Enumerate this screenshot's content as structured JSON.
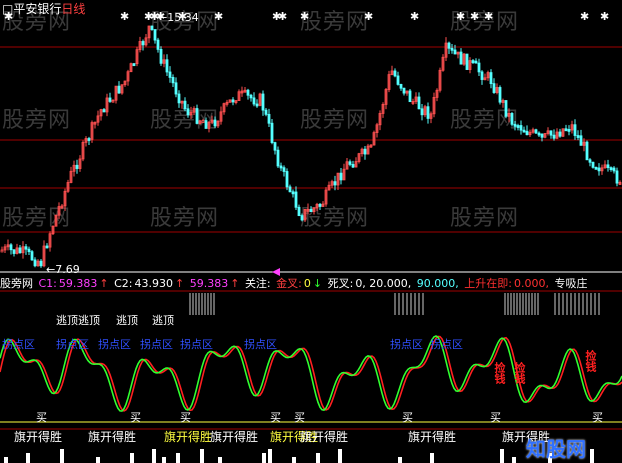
{
  "header": {
    "stock_name": "平安银行",
    "period": "日线"
  },
  "price_chart": {
    "high_label": "15.34",
    "low_label": "7.69"
  },
  "indicator_bar": {
    "source": "股旁网",
    "c1_label": "C1:",
    "c1_value": "59.383",
    "c2_label": "C2:",
    "c2_value": "43.930",
    "c3_value": "59.383",
    "focus_label": "关注:",
    "golden_cross_label": "金叉:",
    "golden_cross_value": "0",
    "death_cross_label": "死叉:",
    "death_cross_values": "0, 20.000,",
    "line90": "90.000,",
    "rise_start_label": "上升在即:",
    "rise_start_value": "0.000,",
    "zhuang_label": "专吸庄"
  },
  "signals": {
    "escape_top": [
      "逃顶",
      "逃顶",
      "逃顶",
      "逃顶"
    ],
    "reversal_zone": [
      "拐点区",
      "拐点区",
      "拐点区",
      "拐点区",
      "拐点区",
      "拐点区",
      "拐点区",
      "拐点区"
    ],
    "buy": [
      "买",
      "买",
      "买",
      "买",
      "买",
      "买",
      "买",
      "买"
    ],
    "flag_win": [
      "旗开得胜",
      "旗开得胜",
      "旗开得胜",
      "旗开得胜",
      "旗开得胜",
      "旗开得胜",
      "旗开得胜",
      "旗开得胜"
    ],
    "hold_stock": [
      "捡钱",
      "捡钱",
      "捡钱"
    ]
  },
  "watermarks": [
    "股旁网",
    "股旁网",
    "股旁网",
    "股旁网",
    "股旁网",
    "股旁网",
    "股旁网",
    "股旁网",
    "股旁网",
    "股旁网",
    "股旁网",
    "股旁网"
  ],
  "logo": "知股网",
  "colors": {
    "up": "#ff5050",
    "down": "#54ffff",
    "grid": "#a00000",
    "osc_red": "#ff2020",
    "osc_green": "#30ff30",
    "yellow": "#ffff40",
    "blue_text": "#3050ff",
    "magenta": "#ff40ff"
  }
}
